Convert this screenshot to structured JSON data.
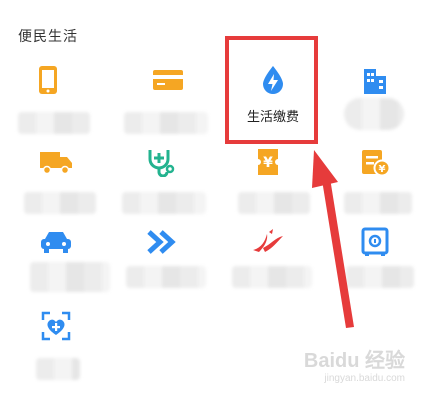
{
  "section": {
    "title": "便民生活"
  },
  "services": [
    {
      "icon": "mobile-phone-icon",
      "color": "#f5a623",
      "label": ""
    },
    {
      "icon": "card-icon",
      "color": "#f5a623",
      "label": ""
    },
    {
      "icon": "water-drop-lightning-icon",
      "color": "#2f8cf0",
      "label": "生活缴费"
    },
    {
      "icon": "buildings-icon",
      "color": "#2f8cf0",
      "label": ""
    },
    {
      "icon": "delivery-truck-icon",
      "color": "#f5a623",
      "label": ""
    },
    {
      "icon": "stethoscope-plus-icon",
      "color": "#23b38f",
      "label": ""
    },
    {
      "icon": "yen-ticket-icon",
      "color": "#f5a623",
      "label": ""
    },
    {
      "icon": "yen-receipt-icon",
      "color": "#f5a623",
      "label": ""
    },
    {
      "icon": "car-icon",
      "color": "#2f8cf0",
      "label": ""
    },
    {
      "icon": "double-chevron-right-icon",
      "color": "#2f8cf0",
      "label": ""
    },
    {
      "icon": "airline-logo-icon",
      "color": "#e63b3b",
      "label": ""
    },
    {
      "icon": "safe-icon",
      "color": "#2f8cf0",
      "label": ""
    },
    {
      "icon": "medical-scan-icon",
      "color": "#2f8cf0",
      "label": ""
    }
  ],
  "annotation": {
    "box_color": "#e63b3b",
    "arrow_color": "#e63b3b"
  },
  "watermark": {
    "main": "Baidu 经验",
    "sub": "jingyan.baidu.com"
  }
}
